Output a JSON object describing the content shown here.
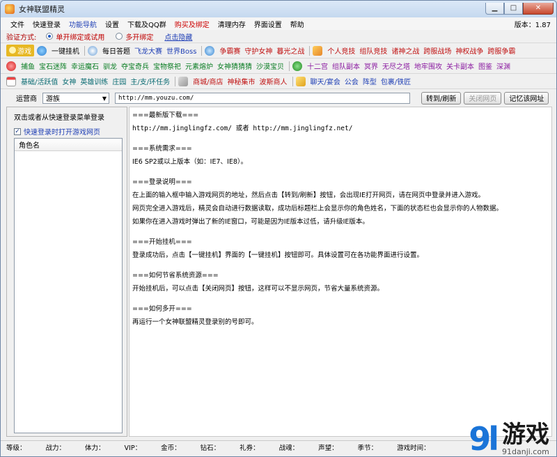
{
  "window": {
    "title": "女神联盟精灵"
  },
  "menu": {
    "items": [
      {
        "label": "文件",
        "style": "normal"
      },
      {
        "label": "快速登录",
        "style": "normal"
      },
      {
        "label": "功能导航",
        "style": "accent"
      },
      {
        "label": "设置",
        "style": "normal"
      },
      {
        "label": "下载及QQ群",
        "style": "normal"
      },
      {
        "label": "购买及绑定",
        "style": "red"
      },
      {
        "label": "清理内存",
        "style": "normal"
      },
      {
        "label": "界面设置",
        "style": "normal"
      },
      {
        "label": "帮助",
        "style": "normal"
      }
    ],
    "version": "版本：1.87"
  },
  "verify": {
    "label": "验证方式:",
    "option1": "单开绑定或试用",
    "option2": "多开绑定",
    "link": "点击隐藏"
  },
  "toolbar1": {
    "game": "游戏",
    "one_click": "一键挂机",
    "items": [
      "每日答题",
      "飞龙大赛",
      "世界Boss"
    ],
    "items2": [
      "争霸赛",
      "守护女神",
      "暮光之战"
    ],
    "items3": [
      "个人竞技",
      "组队竞技",
      "诸神之战",
      "跨服战场",
      "神权战争",
      "跨服争霸"
    ]
  },
  "toolbar2": {
    "items": [
      "捕鱼",
      "宝石迷阵",
      "幸运魔石",
      "驯龙",
      "夺宝奇兵",
      "宝物祭祀",
      "元素熔炉",
      "女神猜猜猜",
      "沙漠宝贝"
    ],
    "items2": [
      "十二宫",
      "组队副本",
      "冥界",
      "无尽之塔",
      "地牢围攻",
      "关卡副本",
      "图鉴",
      "深渊"
    ]
  },
  "toolbar3": {
    "items": [
      "基础/活跃值",
      "女神",
      "英雄训练",
      "庄园",
      "主/支/环任务"
    ],
    "items2": [
      "商城/商店",
      "神秘集市",
      "波斯商人"
    ],
    "items3": [
      "聊天/宴会",
      "公会",
      "阵型",
      "包裹/铁匠"
    ]
  },
  "address": {
    "label": "运营商",
    "operator": "游族",
    "url": "http://mm.youzu.com/",
    "go_btn": "转到/刷新",
    "close_btn": "关闭网页",
    "remember_btn": "记忆该网址"
  },
  "left": {
    "hint": "双击或者从快速登录菜单登录",
    "checkbox": "快速登录时打开游戏网页",
    "column": "角色名"
  },
  "content": {
    "lines": [
      "===最新版下载===",
      "http://mm.jinglingfz.com/ 或者 http://mm.jinglingfz.net/",
      "",
      "===系统需求===",
      "IE6 SP2或以上版本（如：IE7、IE8）。",
      "",
      "===登录说明===",
      "在上面的输入框中输入游戏网页的地址，然后点击【转到/刷新】按钮，会出现IE打开网页，请在网页中登录并进入游戏。",
      "网页完全进入游戏后，精灵会自动进行数据读取，成功后标题栏上会显示你的角色姓名，下面的状态栏也会显示你的人物数据。",
      "如果你在进入游戏时弹出了新的IE窗口，可能是因为IE版本过低，请升级IE版本。",
      "",
      "===开始挂机===",
      "登录成功后，点击【一键挂机】界面的【一键挂机】按钮即可。具体设置可在各功能界面进行设置。",
      "",
      "===如何节省系统资源===",
      "开始挂机后，可以点击【关闭网页】按钮，这样可以不显示网页，节省大量系统资源。",
      "",
      "===如何多开===",
      "再运行一个女神联盟精灵登录别的号即可。"
    ]
  },
  "status": {
    "items": [
      "等级：",
      "战力：",
      "体力：",
      "VIP：",
      "金币：",
      "钻石：",
      "礼券：",
      "战魂：",
      "声望：",
      "季节：",
      "游戏时间："
    ]
  },
  "watermark": {
    "logo": "9",
    "logo_accent": "l",
    "text": "游戏",
    "site": "91danji.com"
  },
  "colors": {
    "accent": "#1f3fb5",
    "red": "#c01010",
    "green": "#0a7d23"
  }
}
